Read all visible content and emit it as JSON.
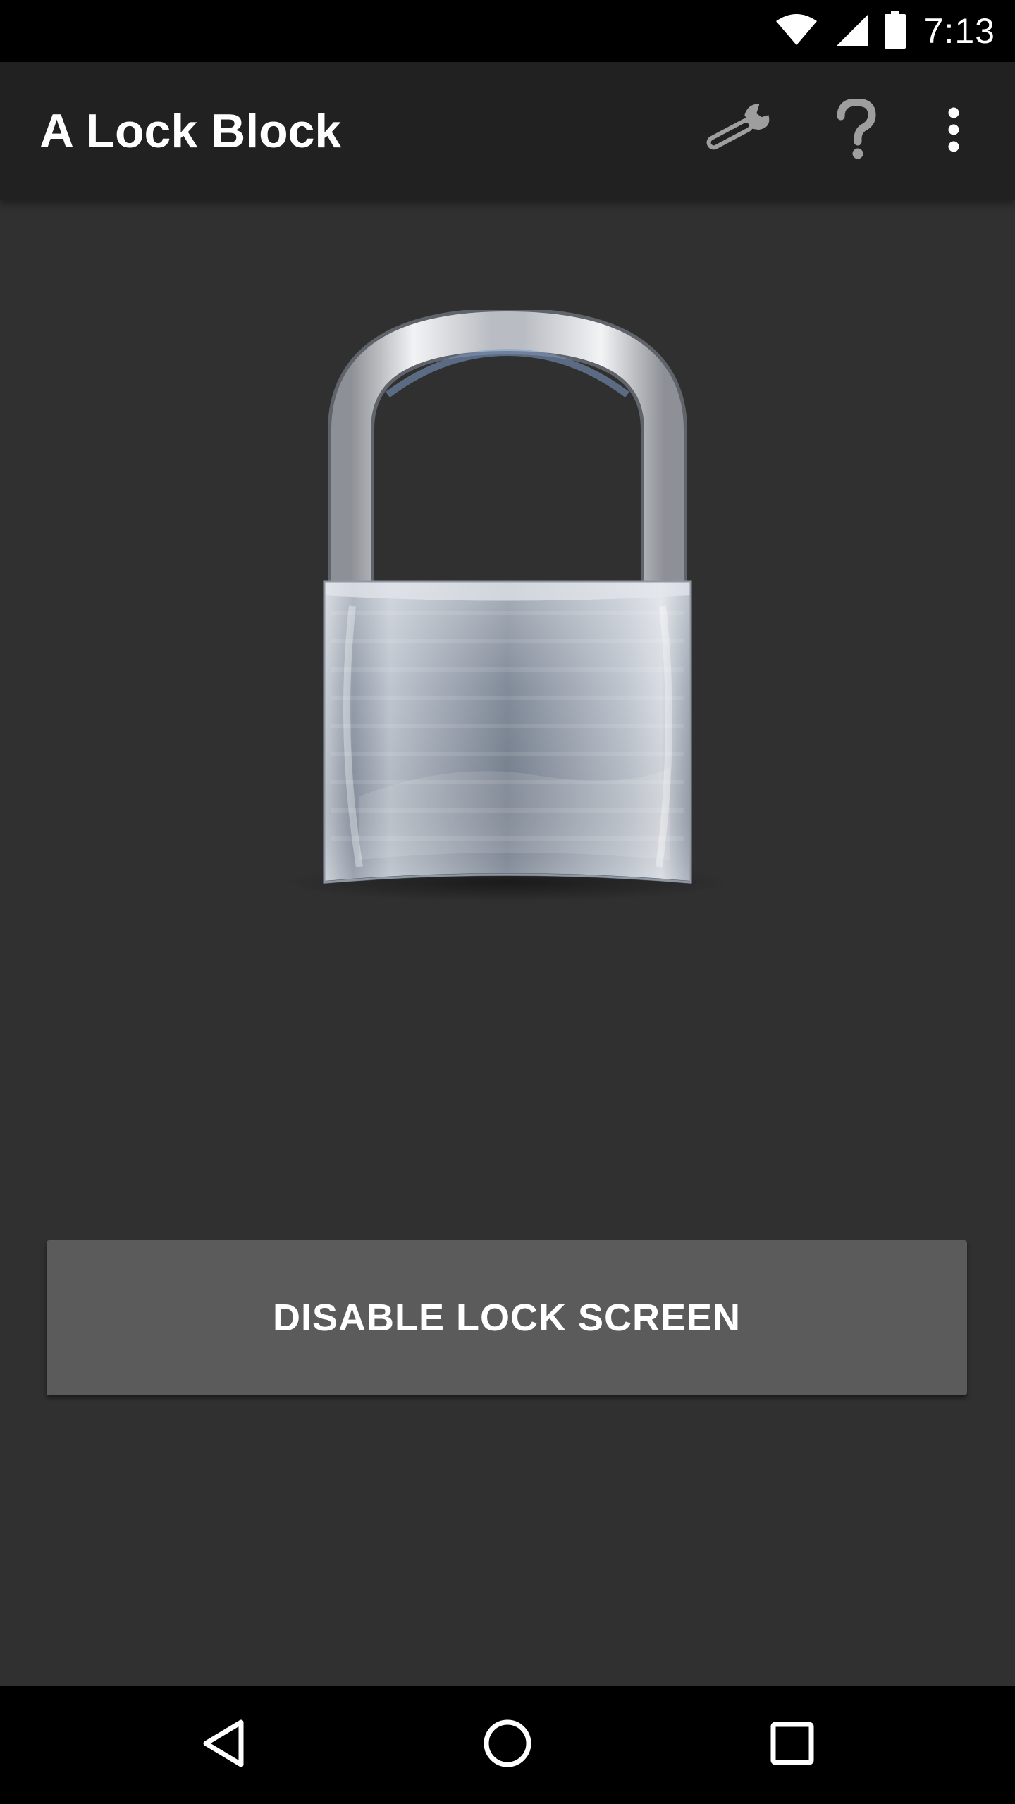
{
  "status_bar": {
    "time": "7:13",
    "icons": [
      "wifi-icon",
      "cell-signal-icon",
      "battery-icon"
    ]
  },
  "app_bar": {
    "title": "A Lock Block",
    "actions": [
      "wrench-icon",
      "help-icon",
      "overflow-menu-icon"
    ]
  },
  "main": {
    "illustration": "padlock-icon",
    "disable_button_label": "DISABLE LOCK SCREEN"
  },
  "nav_bar": {
    "items": [
      "back-icon",
      "home-icon",
      "recents-icon"
    ]
  },
  "colors": {
    "status_bar": "#000000",
    "app_bar": "#212121",
    "background": "#303030",
    "button": "#5b5b5c",
    "text": "#ffffff"
  }
}
